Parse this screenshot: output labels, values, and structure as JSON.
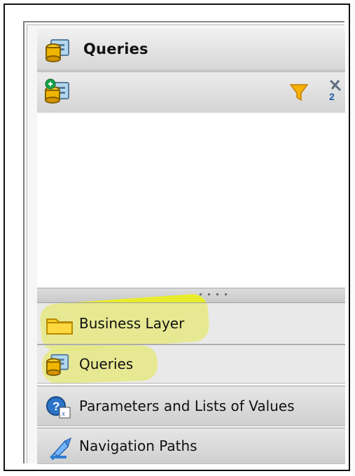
{
  "panel": {
    "title": "Queries"
  },
  "toolbar": {
    "icons": [
      "add-query-icon",
      "filter-icon",
      "sort-icon"
    ]
  },
  "navigation": {
    "items": [
      {
        "label": "Business Layer",
        "icon": "folder-icon",
        "highlighted": true
      },
      {
        "label": "Queries",
        "icon": "queries-icon",
        "highlighted": true
      },
      {
        "label": "Parameters and Lists of Values",
        "icon": "parameters-icon",
        "highlighted": false
      },
      {
        "label": "Navigation Paths",
        "icon": "navigation-paths-icon",
        "highlighted": false
      }
    ]
  },
  "colors": {
    "highlight": "#f0f500",
    "folder": "#f5c400"
  }
}
